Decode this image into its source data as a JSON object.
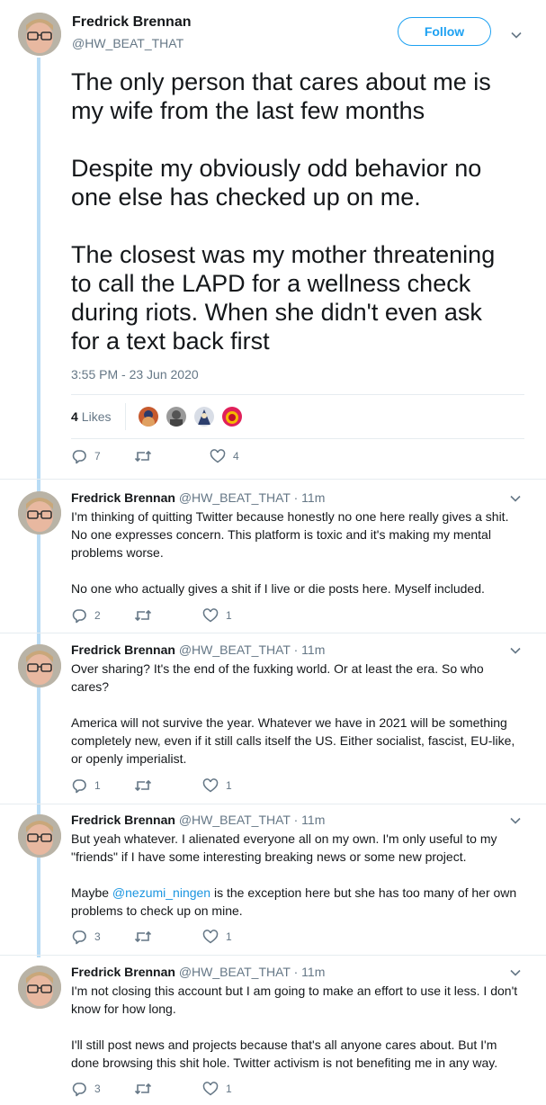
{
  "main_tweet": {
    "author_name": "Fredrick Brennan",
    "author_handle": "@HW_BEAT_THAT",
    "follow_label": "Follow",
    "text": "The only person that cares about me is\nmy wife from the last few months\n\nDespite my obviously odd behavior no\none else has checked up on me.\n\nThe closest was my mother threatening\nto call the LAPD for a wellness check\nduring riots. When she didn't even ask\nfor a text back first",
    "timestamp": "3:55 PM - 23 Jun 2020",
    "likes_count": "4",
    "likes_label": "Likes",
    "reply_count": "7",
    "retweet_count": "",
    "like_count": "4"
  },
  "replies": [
    {
      "name": "Fredrick Brennan",
      "handle": "@HW_BEAT_THAT",
      "time": "· 11m",
      "p1": "I'm thinking of quitting Twitter because honestly no one here really gives a shit. No one expresses concern. This platform is toxic and it's making my mental problems worse.",
      "p2": "No one who actually gives a shit if I live or die posts here. Myself included.",
      "reply_count": "2",
      "like_count": "1"
    },
    {
      "name": "Fredrick Brennan",
      "handle": "@HW_BEAT_THAT",
      "time": "· 11m",
      "p1": "Over sharing? It's the end of the fuxking world. Or at least the era. So who cares?",
      "p2": "America will not survive the year. Whatever we have in 2021 will be something completely new, even if it still calls itself the US. Either socialist, fascist, EU-like, or openly imperialist.",
      "reply_count": "1",
      "like_count": "1"
    },
    {
      "name": "Fredrick Brennan",
      "handle": "@HW_BEAT_THAT",
      "time": "· 11m",
      "p1": "But yeah whatever. I alienated everyone all on my own. I'm only useful to my \"friends\" if I have some interesting breaking news or some new project.",
      "p2_pre": "Maybe ",
      "p2_mention": "@nezumi_ningen",
      "p2_post": " is the exception here but she has too many of her own problems to check up on mine.",
      "reply_count": "3",
      "like_count": "1"
    },
    {
      "name": "Fredrick Brennan",
      "handle": "@HW_BEAT_THAT",
      "time": "· 11m",
      "p1": "I'm not closing this account but I am going to make an effort to use it less. I don't know for how long.",
      "p2": "I'll still post news and projects because that's all anyone cares about. But I'm done browsing this shit hole. Twitter activism is not benefiting me in any way.",
      "reply_count": "3",
      "like_count": "1"
    }
  ],
  "icons": {
    "reply": "reply-icon",
    "retweet": "retweet-icon",
    "like": "heart-icon",
    "caret": "chevron-down-icon"
  },
  "colors": {
    "accent": "#1da1f2",
    "thread_line": "#b9dcf5",
    "muted": "#657786"
  }
}
